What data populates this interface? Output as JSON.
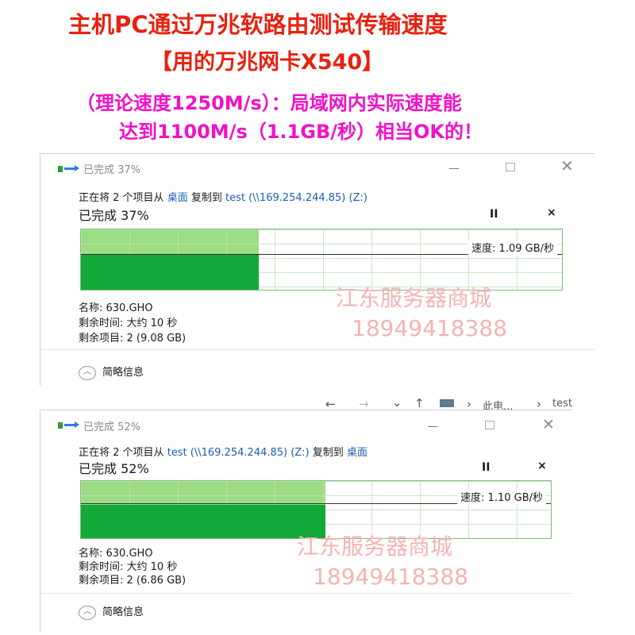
{
  "headline": {
    "line1": "主机PC通过万兆软路由测试传输速度",
    "line2": "【用的万兆网卡X540】",
    "line3": "（理论速度1250M/s）：局域网内实际速度能",
    "line4": "达到1100M/s（1.1GB/秒）相当OK的！"
  },
  "colors": {
    "headline_red": "#e8210f",
    "headline_magenta": "#ef12c7",
    "graph_fill": "#12a83a",
    "graph_bg": "#9ddc84",
    "link_blue": "#1a5fb4",
    "watermark": "#f4b3b3"
  },
  "dialog1": {
    "window_title": "已完成 37%",
    "copy_prefix": "正在将 2 个项目从",
    "copy_from": "桌面",
    "copy_mid": "复制到",
    "copy_to": "test (\\\\169.254.244.85) (Z:)",
    "progress_text": "已完成 37%",
    "progress_fraction": 0.37,
    "pause_label": "II",
    "cancel_label": "×",
    "speed_label": "速度: 1.09 GB/秒",
    "name_line": "名称: 630.GHO",
    "time_line": "剩余时间: 大约 10 秒",
    "items_line": "剩余项目: 2 (9.08 GB)",
    "details_label": "简略信息",
    "details_icon": "chevron-up-icon",
    "watermark_name": "江东服务器商城",
    "watermark_phone": "18949418388"
  },
  "navbar": {
    "back": "←",
    "forward": "→",
    "dropdown": "⌄",
    "up": "↑",
    "sep": "›",
    "loc1": "此电...",
    "loc2": "test"
  },
  "dialog2": {
    "window_title": "已完成 52%",
    "copy_prefix": "正在将 2 个项目从",
    "copy_from": "test (\\\\169.254.244.85) (Z:)",
    "copy_mid": "复制到",
    "copy_to": "桌面",
    "progress_text": "已完成 52%",
    "progress_fraction": 0.52,
    "pause_label": "II",
    "cancel_label": "×",
    "speed_label": "速度: 1.10 GB/秒",
    "name_line": "名称: 630.GHO",
    "time_line": "剩余时间: 大约 10 秒",
    "items_line": "剩余项目: 2 (6.86 GB)",
    "details_label": "简略信息",
    "details_icon": "chevron-up-icon",
    "watermark_name": "江东服务器商城",
    "watermark_phone": "18949418388"
  }
}
